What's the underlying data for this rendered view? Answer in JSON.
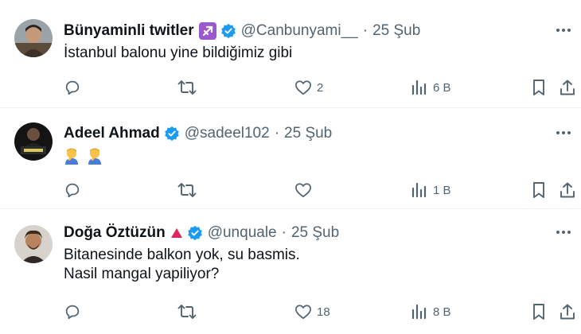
{
  "tweets": [
    {
      "name": "Bünyaminli twitler",
      "badge_emoji": "sagittarius-badge",
      "verified": true,
      "handle": "@Canbunyami__",
      "separator": "·",
      "date": "25 Şub",
      "text_lines": [
        "İstanbul balonu yine bildiğimiz gibi"
      ],
      "replies": "",
      "retweets": "",
      "likes": "2",
      "views": "6 B"
    },
    {
      "name": "Adeel Ahmad",
      "verified": true,
      "handle": "@sadeel102",
      "separator": "·",
      "date": "25 Şub",
      "text_emojis": [
        "person-facepalming-emoji",
        "person-facepalming-emoji"
      ],
      "replies": "",
      "retweets": "",
      "likes": "",
      "views": "1 B"
    },
    {
      "name": "Doğa Öztüzün",
      "badge_emoji": "red-triangle",
      "verified": true,
      "handle": "@unquale",
      "separator": "·",
      "date": "25 Şub",
      "text_lines": [
        "Bitanesinde balkon yok, su basmis.",
        "Nasil mangal yapiliyor?"
      ],
      "replies": "",
      "retweets": "",
      "likes": "18",
      "views": "8 B"
    }
  ],
  "colors": {
    "text": "#0f1419",
    "secondary": "#536471",
    "verified": "#1d9bf0",
    "divider": "#eff3f4",
    "sagittarius_badge": "#9b59d0",
    "triangle": "#e0245e"
  }
}
